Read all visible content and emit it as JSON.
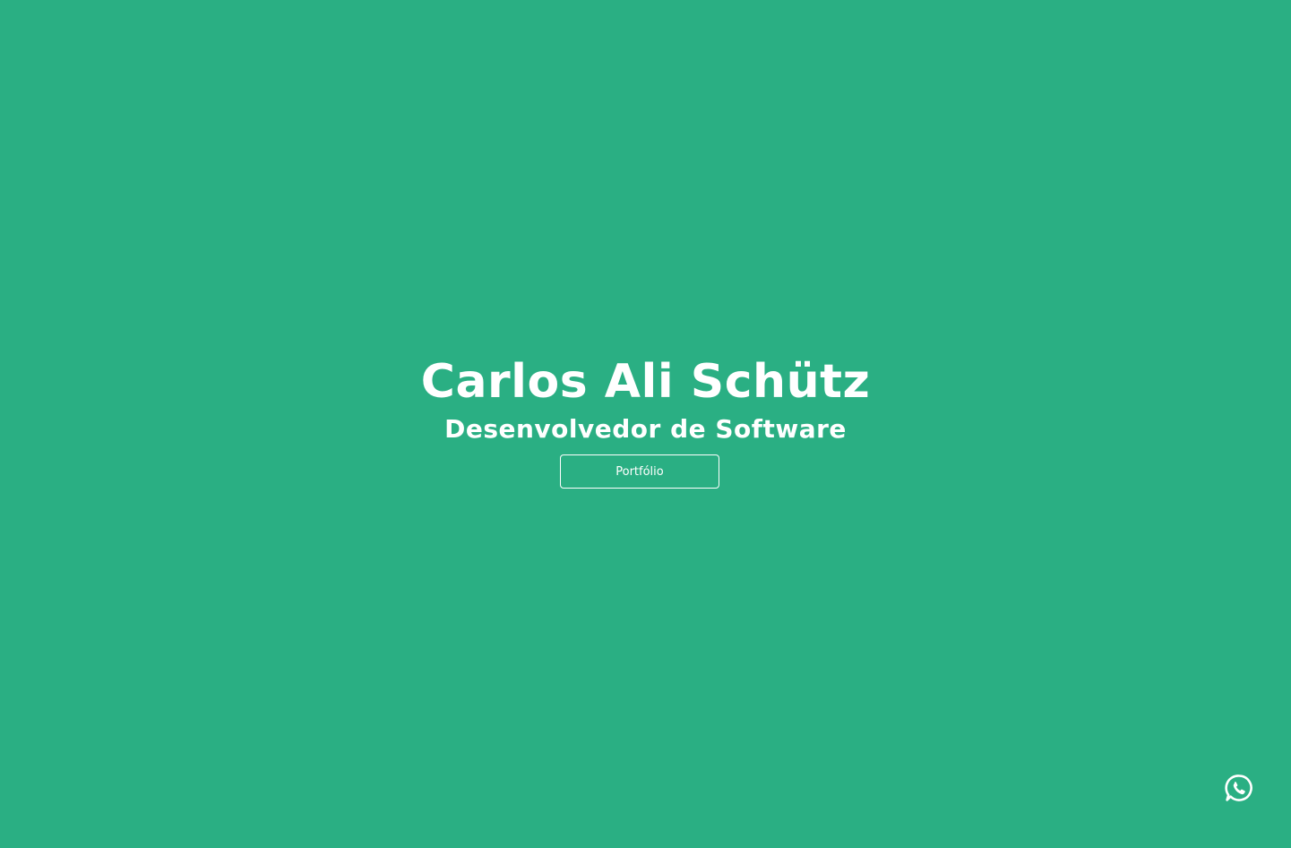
{
  "hero": {
    "name": "Carlos Ali Schütz",
    "role": "Desenvolvedor de Software",
    "cta_label": "Portfólio"
  },
  "floating": {
    "icon": "whatsapp-icon"
  },
  "colors": {
    "background": "#2aaf83",
    "text": "#ffffff"
  }
}
